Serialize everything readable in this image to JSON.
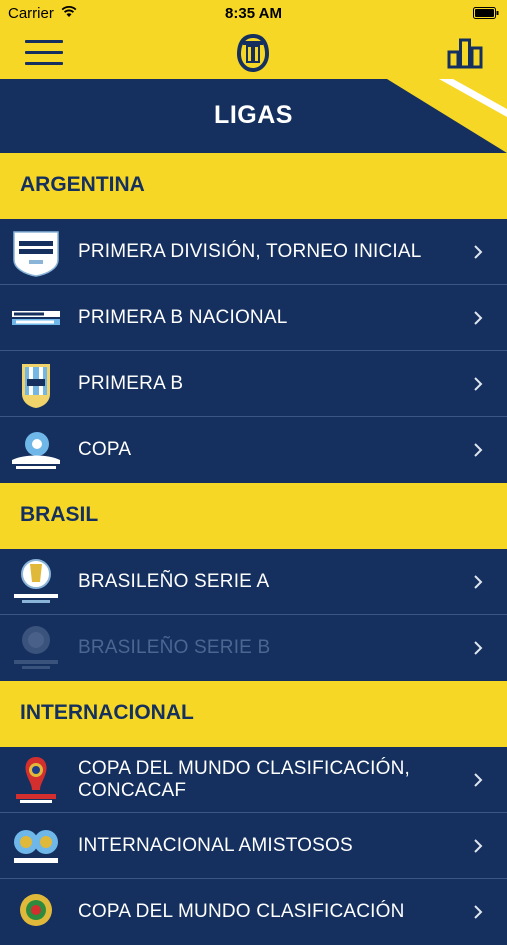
{
  "status": {
    "carrier": "Carrier",
    "time": "8:35 AM"
  },
  "header": {
    "title": "LIGAS"
  },
  "colors": {
    "primary": "#15305e",
    "accent": "#f6d726",
    "text": "#ffffff",
    "disabled_text": "#4c6591"
  },
  "icons": {
    "menu": "hamburger-menu-icon",
    "logo": "club-crest-logo",
    "stats": "bar-chart-icon",
    "chevron": "chevron-right-icon"
  },
  "sections": [
    {
      "name": "ARGENTINA",
      "items": [
        {
          "label": "PRIMERA DIVISIÓN, TORNEO INICIAL",
          "icon": "primera-division-logo",
          "enabled": true
        },
        {
          "label": "PRIMERA B NACIONAL",
          "icon": "primera-b-nacional-logo",
          "enabled": true
        },
        {
          "label": "PRIMERA B",
          "icon": "afa-logo",
          "enabled": true
        },
        {
          "label": "COPA",
          "icon": "copa-argentina-logo",
          "enabled": true
        }
      ]
    },
    {
      "name": "BRASIL",
      "items": [
        {
          "label": "BRASILEÑO SERIE A",
          "icon": "brasileirao-serie-a-logo",
          "enabled": true
        },
        {
          "label": "BRASILEÑO SERIE B",
          "icon": "brasileirao-serie-b-logo",
          "enabled": false
        }
      ]
    },
    {
      "name": "INTERNACIONAL",
      "items": [
        {
          "label": "COPA DEL MUNDO CLASIFICACIÓN, CONCACAF",
          "icon": "world-cup-2018-logo",
          "enabled": true
        },
        {
          "label": "INTERNACIONAL AMISTOSOS",
          "icon": "international-friendlies-logo",
          "enabled": true
        },
        {
          "label": "COPA DEL MUNDO CLASIFICACIÓN",
          "icon": "conmebol-qualifiers-logo",
          "enabled": true
        }
      ]
    }
  ]
}
